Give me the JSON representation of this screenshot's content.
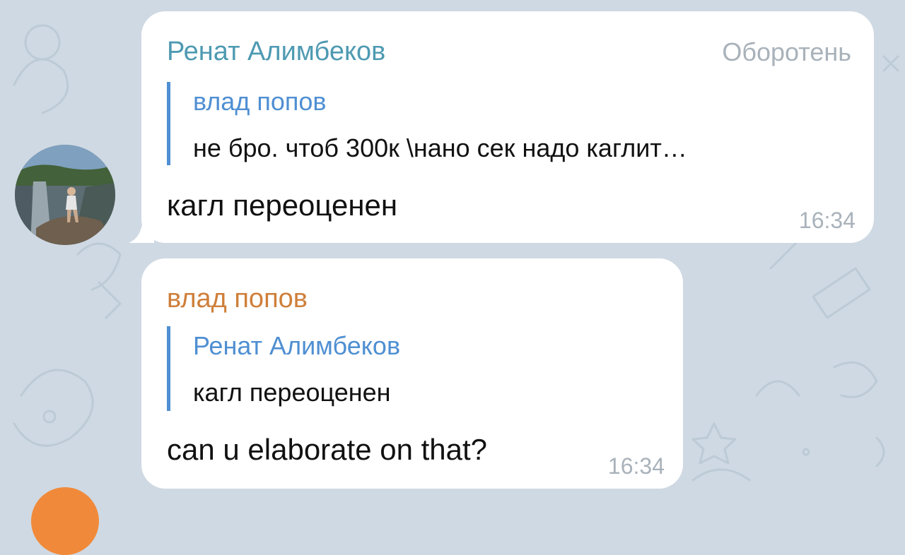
{
  "chat": {
    "messages": [
      {
        "sender": "Ренат Алимбеков",
        "role": "Оборотень",
        "reply_to": {
          "name": "влад попов",
          "text": "не бро. чтоб 300к \\нано сек надо каглит…"
        },
        "text": "кагл переоценен",
        "time": "16:34",
        "avatar": "user-photo-avatar"
      },
      {
        "sender": "влад попов",
        "reply_to": {
          "name": "Ренат Алимбеков",
          "text": "кагл переоценен"
        },
        "text": "can u elaborate on that?",
        "time": "16:34",
        "avatar": "orange-avatar"
      }
    ]
  },
  "colors": {
    "background": "#cfd9e3",
    "bubble": "#ffffff",
    "sender1": "#4e9ab2",
    "sender2": "#cf7f3a",
    "reply_accent": "#4f8fd2",
    "meta_text": "#a9b2ba"
  }
}
